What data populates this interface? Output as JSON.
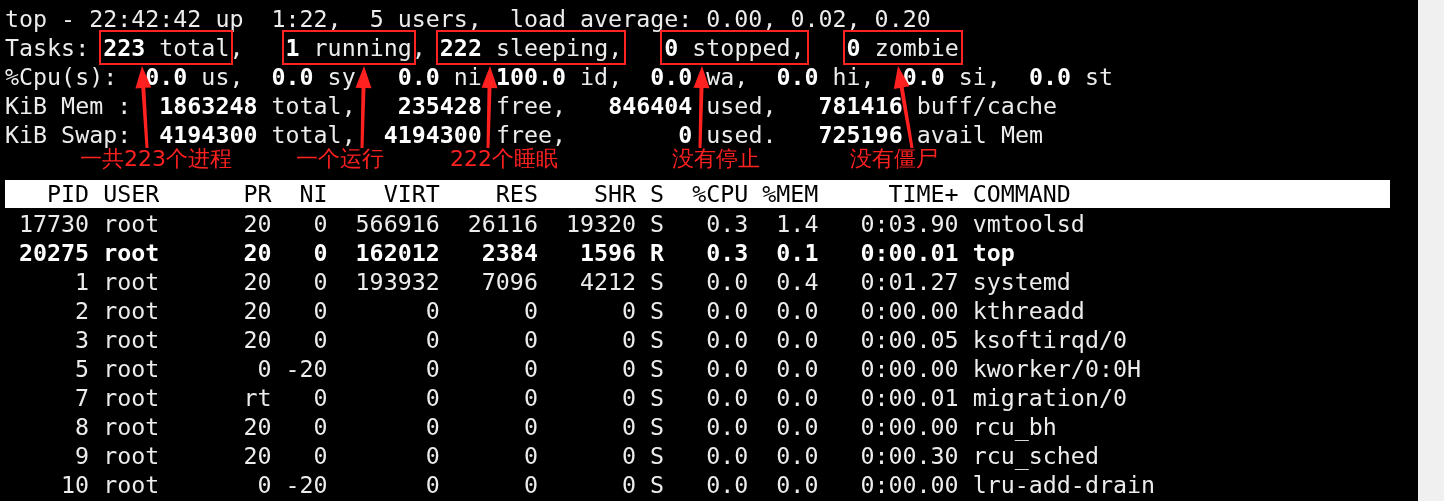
{
  "summary_lines": [
    [
      {
        "text": "top - 22:42:42 up  1:22,  5 users,  load average: 0.00, 0.02, 0.20",
        "boxed": false
      }
    ],
    [
      {
        "text": "Tasks: ",
        "boxed": false
      },
      {
        "text": "**223** total",
        "boxed": true
      },
      {
        "text": ",   ",
        "boxed": false
      },
      {
        "text": "**1** running",
        "boxed": true
      },
      {
        "text": ", ",
        "boxed": false
      },
      {
        "text": "**222** sleeping,",
        "boxed": true
      },
      {
        "text": "   **0** stopped,",
        "boxed": true
      },
      {
        "text": "   **0** zombie",
        "boxed": true
      }
    ],
    [
      {
        "text": "%Cpu(s):  **0.0** us,  **0.0** sy,  **0.0** ni,**100.0** id,  **0.0** wa,  **0.0** hi,  **0.0** si,  **0.0** st",
        "boxed": false
      }
    ],
    [
      {
        "text": "KiB Mem :  **1863248** total,   **235428** free,   **846404** used,   **781416** buff/cache",
        "boxed": false
      }
    ],
    [
      {
        "text": "KiB Swap:  **4194300** total,  **4194300** free,        **0** used.   **725196** avail Mem",
        "boxed": false
      }
    ]
  ],
  "annotations": [
    {
      "label": "一共223个进程"
    },
    {
      "label": "一个运行"
    },
    {
      "label": "222个睡眠"
    },
    {
      "label": "没有停止"
    },
    {
      "label": "没有僵尸"
    }
  ],
  "table": {
    "columns": [
      "PID",
      "USER",
      "PR",
      "NI",
      "VIRT",
      "RES",
      "SHR",
      "S",
      "%CPU",
      "%MEM",
      "TIME+",
      "COMMAND"
    ],
    "rows": [
      {
        "highlighted": false,
        "cells": [
          "17730",
          "root",
          "20",
          "0",
          "566916",
          "26116",
          "19320",
          "S",
          "0.3",
          "1.4",
          "0:03.90",
          "vmtoolsd"
        ]
      },
      {
        "highlighted": true,
        "cells": [
          "20275",
          "root",
          "20",
          "0",
          "162012",
          "2384",
          "1596",
          "R",
          "0.3",
          "0.1",
          "0:00.01",
          "top"
        ]
      },
      {
        "highlighted": false,
        "cells": [
          "1",
          "root",
          "20",
          "0",
          "193932",
          "7096",
          "4212",
          "S",
          "0.0",
          "0.4",
          "0:01.27",
          "systemd"
        ]
      },
      {
        "highlighted": false,
        "cells": [
          "2",
          "root",
          "20",
          "0",
          "0",
          "0",
          "0",
          "S",
          "0.0",
          "0.0",
          "0:00.00",
          "kthreadd"
        ]
      },
      {
        "highlighted": false,
        "cells": [
          "3",
          "root",
          "20",
          "0",
          "0",
          "0",
          "0",
          "S",
          "0.0",
          "0.0",
          "0:00.05",
          "ksoftirqd/0"
        ]
      },
      {
        "highlighted": false,
        "cells": [
          "5",
          "root",
          "0",
          "-20",
          "0",
          "0",
          "0",
          "S",
          "0.0",
          "0.0",
          "0:00.00",
          "kworker/0:0H"
        ]
      },
      {
        "highlighted": false,
        "cells": [
          "7",
          "root",
          "rt",
          "0",
          "0",
          "0",
          "0",
          "S",
          "0.0",
          "0.0",
          "0:00.01",
          "migration/0"
        ]
      },
      {
        "highlighted": false,
        "cells": [
          "8",
          "root",
          "20",
          "0",
          "0",
          "0",
          "0",
          "S",
          "0.0",
          "0.0",
          "0:00.00",
          "rcu_bh"
        ]
      },
      {
        "highlighted": false,
        "cells": [
          "9",
          "root",
          "20",
          "0",
          "0",
          "0",
          "0",
          "S",
          "0.0",
          "0.0",
          "0:00.30",
          "rcu_sched"
        ]
      },
      {
        "highlighted": false,
        "cells": [
          "10",
          "root",
          "0",
          "-20",
          "0",
          "0",
          "0",
          "S",
          "0.0",
          "0.0",
          "0:00.00",
          "lru-add-drain"
        ]
      }
    ]
  }
}
